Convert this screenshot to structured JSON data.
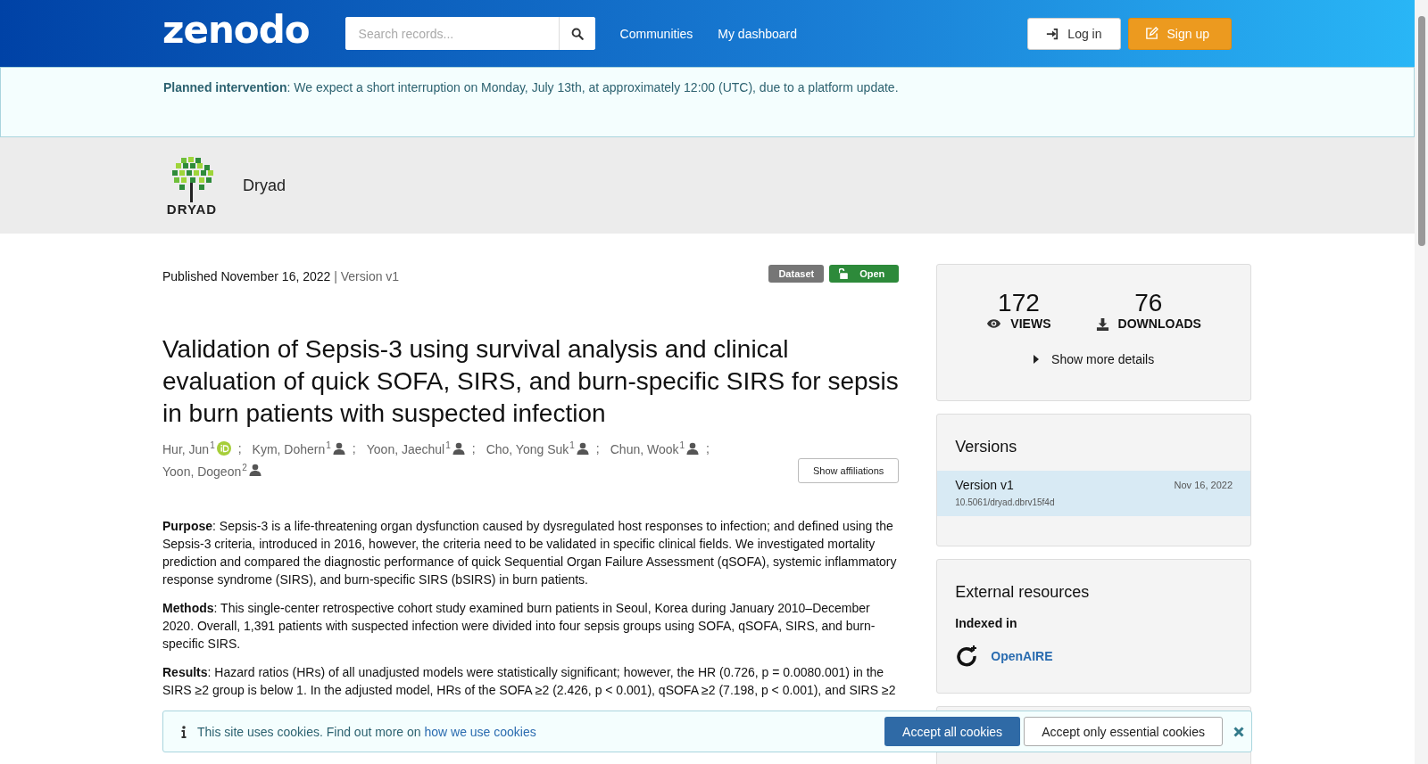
{
  "header": {
    "logo": "zenodo",
    "search": {
      "placeholder": "Search records..."
    },
    "nav": [
      "Communities",
      "My dashboard"
    ],
    "login": "Log in",
    "signup": "Sign up"
  },
  "notice": {
    "label": "Planned intervention",
    "text": ": We expect a short interruption on Monday, July 13th, at approximately 12:00 (UTC), due to a platform update."
  },
  "community": {
    "logo_text": "DRYAD",
    "name": "Dryad"
  },
  "record": {
    "published": "Published November 16, 2022",
    "version": "| Version v1",
    "badges": [
      {
        "label": "Dataset",
        "kind": "type"
      },
      {
        "label": "Open",
        "kind": "access"
      }
    ],
    "title": "Validation of Sepsis-3 using survival analysis and clinical evaluation of quick SOFA, SIRS, and burn-specific SIRS for sepsis in burn patients with suspected infection",
    "authors": [
      {
        "name": "Hur, Jun",
        "aff": "1",
        "kind": "orcid",
        "sep": ";"
      },
      {
        "name": "Kym, Dohern",
        "aff": "1",
        "kind": "person",
        "sep": ";"
      },
      {
        "name": "Yoon, Jaechul",
        "aff": "1",
        "kind": "person",
        "sep": ";"
      },
      {
        "name": "Cho, Yong Suk",
        "aff": "1",
        "kind": "person",
        "sep": ";"
      },
      {
        "name": "Chun, Wook",
        "aff": "1",
        "kind": "person",
        "sep": ";"
      },
      {
        "name": "Yoon, Dogeon",
        "aff": "2",
        "kind": "person"
      }
    ],
    "show_affiliations": "Show affiliations",
    "abstract": [
      "**Purpose**: Sepsis-3 is a life-threatening organ dysfunction caused by dysregulated host responses to infection; and defined using the Sepsis-3 criteria, introduced in 2016, however, the criteria need to be validated in specific clinical fields. We investigated mortality prediction and compared the diagnostic performance of quick Sequential Organ Failure Assessment (qSOFA), systemic inflammatory response syndrome (SIRS), and burn-specific SIRS (bSIRS) in burn patients.",
      "**Methods**: This single-center retrospective cohort study examined burn patients in Seoul, Korea during January 2010–December 2020. Overall, 1,391 patients with suspected infection were divided into four sepsis groups using SOFA, qSOFA, SIRS, and burn-specific SIRS.",
      "**Results**: Hazard ratios (HRs) of all unadjusted models were statistically significant; however, the HR (0.726, p = 0.0080.001) in the SIRS ≥2 group is below 1. In the adjusted model, HRs of the SOFA ≥2 (2.426, p < 0.001), qSOFA ≥2 (7.198, p < 0.001), and SIRS ≥2"
    ]
  },
  "stats": {
    "views": "172",
    "views_label": "VIEWS",
    "downloads": "76",
    "downloads_label": "DOWNLOADS",
    "more": "Show more details"
  },
  "versions": {
    "title": "Versions",
    "items": [
      {
        "label": "Version v1",
        "date": "Nov 16, 2022",
        "doi": "10.5061/dryad.dbrv15f4d",
        "selected": true
      }
    ]
  },
  "external": {
    "title": "External resources",
    "subtitle": "Indexed in",
    "link": "OpenAIRE"
  },
  "cookies": {
    "text": "This site uses cookies. Find out more on ",
    "link": "how we use cookies",
    "accept_all": "Accept all cookies",
    "accept_essential": "Accept only essential cookies"
  }
}
